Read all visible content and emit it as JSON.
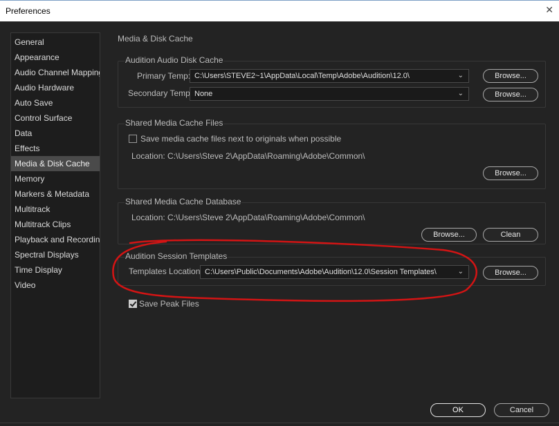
{
  "window": {
    "title": "Preferences",
    "close_icon": "close-icon"
  },
  "sidebar": {
    "items": [
      {
        "label": "General",
        "selected": false
      },
      {
        "label": "Appearance",
        "selected": false
      },
      {
        "label": "Audio Channel Mapping",
        "selected": false
      },
      {
        "label": "Audio Hardware",
        "selected": false
      },
      {
        "label": "Auto Save",
        "selected": false
      },
      {
        "label": "Control Surface",
        "selected": false
      },
      {
        "label": "Data",
        "selected": false
      },
      {
        "label": "Effects",
        "selected": false
      },
      {
        "label": "Media & Disk Cache",
        "selected": true
      },
      {
        "label": "Memory",
        "selected": false
      },
      {
        "label": "Markers & Metadata",
        "selected": false
      },
      {
        "label": "Multitrack",
        "selected": false
      },
      {
        "label": "Multitrack Clips",
        "selected": false
      },
      {
        "label": "Playback and Recording",
        "selected": false
      },
      {
        "label": "Spectral Displays",
        "selected": false
      },
      {
        "label": "Time Display",
        "selected": false
      },
      {
        "label": "Video",
        "selected": false
      }
    ]
  },
  "main": {
    "page_title": "Media & Disk Cache",
    "disk_cache": {
      "title": "Audition Audio Disk Cache",
      "primary_label": "Primary Temp:",
      "primary_value": "C:\\Users\\STEVE2~1\\AppData\\Local\\Temp\\Adobe\\Audition\\12.0\\",
      "secondary_label": "Secondary Temp:",
      "secondary_value": "None",
      "browse_label": "Browse..."
    },
    "shared_files": {
      "title": "Shared Media Cache Files",
      "checkbox_label": "Save media cache files next to originals when possible",
      "checkbox_checked": false,
      "location": "Location: C:\\Users\\Steve 2\\AppData\\Roaming\\Adobe\\Common\\",
      "browse_label": "Browse..."
    },
    "shared_db": {
      "title": "Shared Media Cache Database",
      "location": "Location: C:\\Users\\Steve 2\\AppData\\Roaming\\Adobe\\Common\\",
      "browse_label": "Browse...",
      "clean_label": "Clean"
    },
    "session_templates": {
      "title": "Audition Session Templates",
      "location_label": "Templates Location:",
      "location_value": "C:\\Users\\Public\\Documents\\Adobe\\Audition\\12.0\\Session Templates\\",
      "browse_label": "Browse..."
    },
    "peak_files": {
      "label": "Save Peak Files",
      "checked": true
    }
  },
  "footer": {
    "ok_label": "OK",
    "cancel_label": "Cancel"
  },
  "colors": {
    "background": "#232323",
    "annotation": "#d41414",
    "selected": "#4a4a4a"
  }
}
